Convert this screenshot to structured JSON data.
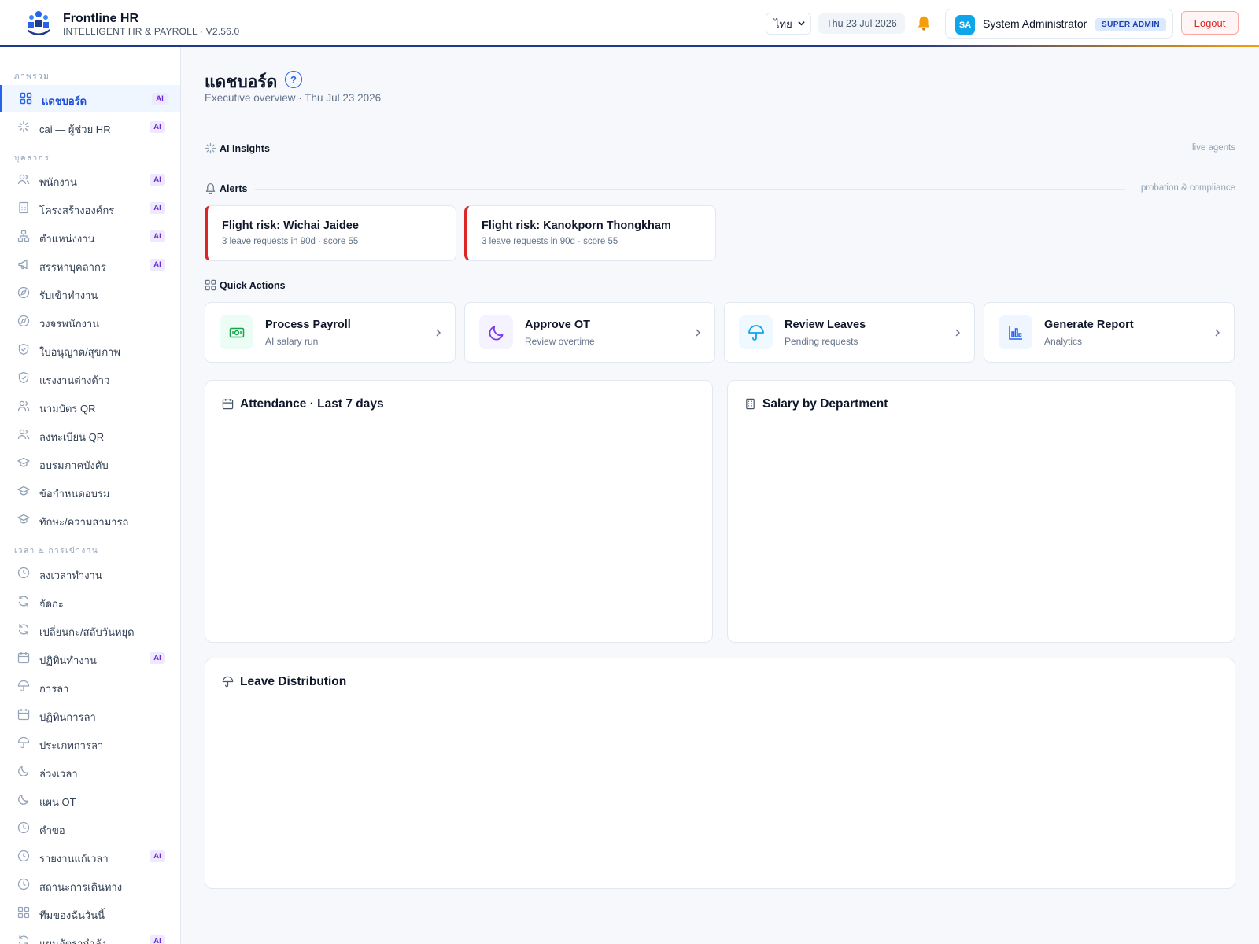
{
  "header": {
    "brand_title": "Frontline HR",
    "brand_subtitle": "INTELLIGENT HR & PAYROLL · V2.56.0",
    "language": "ไทย",
    "date": "Thu 23 Jul 2026",
    "user": {
      "initials": "SA",
      "name": "System Administrator",
      "role": "SUPER ADMIN"
    },
    "logout_label": "Logout",
    "colors": {
      "brand": "#1e3a8a",
      "accent": "#f59e0b",
      "logout": "#dc2626"
    }
  },
  "sidebar": {
    "sections": [
      {
        "label": "ภาพรวม"
      },
      {
        "label": "บุคลากร"
      },
      {
        "label": "เวลา & การเข้างาน"
      }
    ],
    "ai_badge": "AI",
    "items": [
      {
        "label": "แดชบอร์ด",
        "icon": "grid-icon",
        "ai": true,
        "active": true
      },
      {
        "label": "cai — ผู้ช่วย HR",
        "icon": "sparkle-icon",
        "ai": true
      },
      {
        "label": "พนักงาน",
        "icon": "users-icon",
        "ai": true
      },
      {
        "label": "โครงสร้างองค์กร",
        "icon": "building-icon",
        "ai": true
      },
      {
        "label": "ตำแหน่งงาน",
        "icon": "org-chart-icon",
        "ai": true
      },
      {
        "label": "สรรหาบุคลากร",
        "icon": "megaphone-icon",
        "ai": true
      },
      {
        "label": "รับเข้าทำงาน",
        "icon": "compass-icon"
      },
      {
        "label": "วงจรพนักงาน",
        "icon": "compass-icon"
      },
      {
        "label": "ใบอนุญาต/สุขภาพ",
        "icon": "shield-icon"
      },
      {
        "label": "แรงงานต่างด้าว",
        "icon": "shield-icon"
      },
      {
        "label": "นามบัตร QR",
        "icon": "users-icon"
      },
      {
        "label": "ลงทะเบียน QR",
        "icon": "users-icon"
      },
      {
        "label": "อบรมภาคบังคับ",
        "icon": "graduation-icon"
      },
      {
        "label": "ข้อกำหนดอบรม",
        "icon": "graduation-icon"
      },
      {
        "label": "ทักษะ/ความสามารถ",
        "icon": "graduation-icon"
      },
      {
        "label": "ลงเวลาทำงาน",
        "icon": "clock-icon"
      },
      {
        "label": "จัดกะ",
        "icon": "refresh-icon"
      },
      {
        "label": "เปลี่ยนกะ/สลับวันหยุด",
        "icon": "refresh-icon"
      },
      {
        "label": "ปฏิทินทำงาน",
        "icon": "calendar-icon",
        "ai": true
      },
      {
        "label": "การลา",
        "icon": "umbrella-icon"
      },
      {
        "label": "ปฏิทินการลา",
        "icon": "calendar-icon"
      },
      {
        "label": "ประเภทการลา",
        "icon": "umbrella-icon"
      },
      {
        "label": "ล่วงเวลา",
        "icon": "moon-icon"
      },
      {
        "label": "แผน OT",
        "icon": "moon-icon"
      },
      {
        "label": "คำขอ",
        "icon": "clock-icon"
      },
      {
        "label": "รายงานแก้เวลา",
        "icon": "clock-icon",
        "ai": true
      },
      {
        "label": "สถานะการเดินทาง",
        "icon": "clock-icon"
      },
      {
        "label": "ทีมของฉันวันนี้",
        "icon": "grid-icon"
      },
      {
        "label": "แผนอัตรากำลัง",
        "icon": "refresh-icon",
        "ai": true
      }
    ]
  },
  "main": {
    "title": "แดชบอร์ด",
    "help": "?",
    "subtitle": "Executive overview · Thu Jul 23 2026",
    "ai_insights": {
      "title": "AI Insights",
      "right": "live agents"
    },
    "alerts": {
      "title": "Alerts",
      "right": "probation & compliance",
      "cards": [
        {
          "title": "Flight risk: Wichai Jaidee",
          "subtitle": "3 leave requests in 90d · score 55"
        },
        {
          "title": "Flight risk: Kanokporn Thongkham",
          "subtitle": "3 leave requests in 90d · score 55"
        }
      ]
    },
    "quick_actions": {
      "title": "Quick Actions",
      "items": [
        {
          "title": "Process Payroll",
          "subtitle": "AI salary run",
          "icon": "banknote-icon",
          "color": "#16a34a",
          "bg": "#ecfdf5"
        },
        {
          "title": "Approve OT",
          "subtitle": "Review overtime",
          "icon": "moon-icon",
          "color": "#7c3aed",
          "bg": "#f5f3ff"
        },
        {
          "title": "Review Leaves",
          "subtitle": "Pending requests",
          "icon": "umbrella-icon",
          "color": "#0ea5e9",
          "bg": "#f0f9ff"
        },
        {
          "title": "Generate Report",
          "subtitle": "Analytics",
          "icon": "bar-chart-icon",
          "color": "#2563eb",
          "bg": "#eff6ff"
        }
      ]
    },
    "panels": [
      {
        "title": "Attendance · Last 7 days",
        "icon": "calendar-icon"
      },
      {
        "title": "Salary by Department",
        "icon": "building-icon"
      },
      {
        "title": "Leave Distribution",
        "icon": "umbrella-icon"
      }
    ]
  }
}
